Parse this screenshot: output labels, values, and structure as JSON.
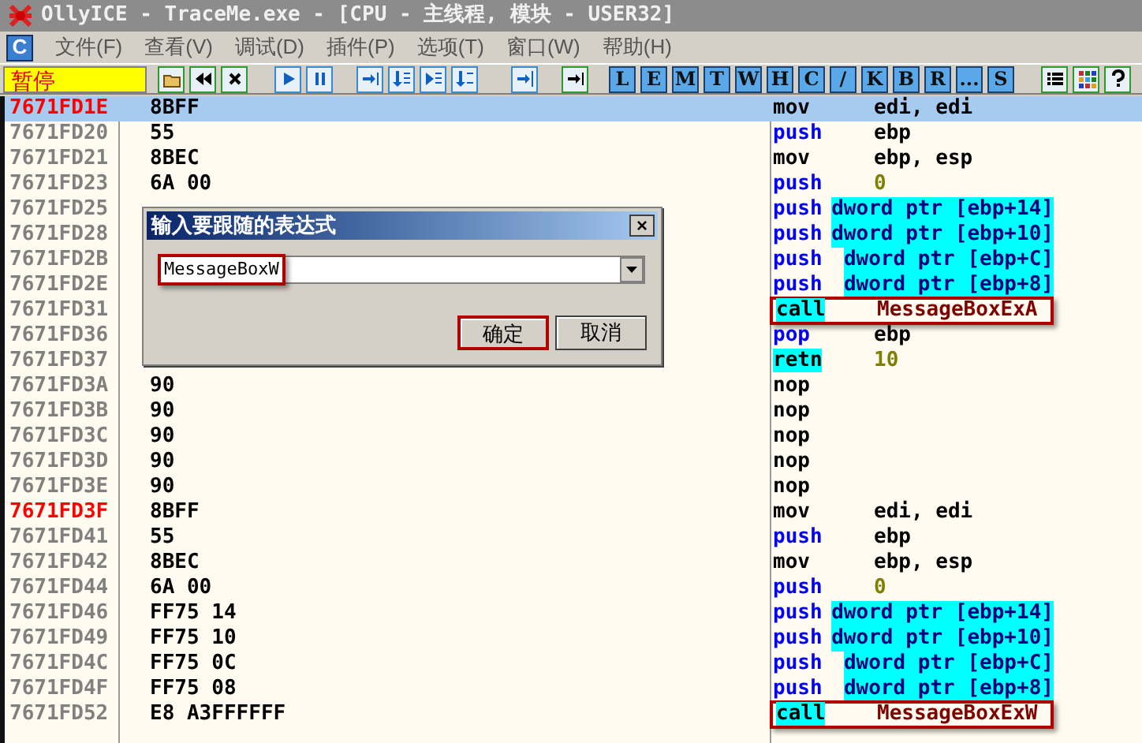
{
  "window": {
    "title": "OllyICE - TraceMe.exe - [CPU - 主线程, 模块 - USER32]"
  },
  "menu": {
    "app_icon_letter": "C",
    "items": [
      "文件(F)",
      "查看(V)",
      "调试(D)",
      "插件(P)",
      "选项(T)",
      "窗口(W)",
      "帮助(H)"
    ]
  },
  "toolbar": {
    "status": "暂停",
    "view_buttons": [
      "L",
      "E",
      "M",
      "T",
      "W",
      "H",
      "C",
      "/",
      "K",
      "B",
      "R",
      "...",
      "S"
    ]
  },
  "disassembly": {
    "rows": [
      {
        "address": "7671FD1E",
        "hex": "8BFF",
        "mnemonic": "mov",
        "kind": "plain",
        "operand": {
          "text": "edi, edi",
          "kind": "reg"
        },
        "selected": true,
        "entry": true,
        "annotated": false
      },
      {
        "address": "7671FD20",
        "hex": "55",
        "mnemonic": "push",
        "kind": "stack",
        "operand": {
          "text": "ebp",
          "kind": "reg"
        },
        "selected": false,
        "entry": false,
        "annotated": false
      },
      {
        "address": "7671FD21",
        "hex": "8BEC",
        "mnemonic": "mov",
        "kind": "plain",
        "operand": {
          "text": "ebp, esp",
          "kind": "reg"
        },
        "selected": false,
        "entry": false,
        "annotated": false
      },
      {
        "address": "7671FD23",
        "hex": "6A 00",
        "mnemonic": "push",
        "kind": "stack",
        "operand": {
          "text": "0",
          "kind": "const"
        },
        "selected": false,
        "entry": false,
        "annotated": false
      },
      {
        "address": "7671FD25",
        "mnemonic": "push",
        "kind": "stack",
        "operand": {
          "text": "dword ptr [ebp+14]",
          "kind": "mem"
        },
        "selected": false,
        "entry": false,
        "annotated": false
      },
      {
        "address": "7671FD28",
        "mnemonic": "push",
        "kind": "stack",
        "operand": {
          "text": "dword ptr [ebp+10]",
          "kind": "mem"
        },
        "selected": false,
        "entry": false,
        "annotated": false
      },
      {
        "address": "7671FD2B",
        "mnemonic": "push",
        "kind": "stack",
        "operand": {
          "text": "dword ptr [ebp+C]",
          "kind": "mem"
        },
        "selected": false,
        "entry": false,
        "annotated": false
      },
      {
        "address": "7671FD2E",
        "mnemonic": "push",
        "kind": "stack",
        "operand": {
          "text": "dword ptr [ebp+8]",
          "kind": "mem"
        },
        "selected": false,
        "entry": false,
        "annotated": false
      },
      {
        "address": "7671FD31",
        "mnemonic": "call",
        "kind": "call",
        "operand": {
          "text": "MessageBoxExA",
          "kind": "symbol"
        },
        "selected": false,
        "entry": false,
        "annotated": true
      },
      {
        "address": "7671FD36",
        "mnemonic": "pop",
        "kind": "stack",
        "operand": {
          "text": "ebp",
          "kind": "reg"
        },
        "selected": false,
        "entry": false,
        "annotated": false
      },
      {
        "address": "7671FD37",
        "mnemonic": "retn",
        "kind": "return",
        "operand": {
          "text": "10",
          "kind": "const"
        },
        "selected": false,
        "entry": false,
        "annotated": false
      },
      {
        "address": "7671FD3A",
        "hex": "90",
        "mnemonic": "nop",
        "kind": "plain",
        "selected": false,
        "entry": false,
        "annotated": false
      },
      {
        "address": "7671FD3B",
        "hex": "90",
        "mnemonic": "nop",
        "kind": "plain",
        "selected": false,
        "entry": false,
        "annotated": false
      },
      {
        "address": "7671FD3C",
        "hex": "90",
        "mnemonic": "nop",
        "kind": "plain",
        "selected": false,
        "entry": false,
        "annotated": false
      },
      {
        "address": "7671FD3D",
        "hex": "90",
        "mnemonic": "nop",
        "kind": "plain",
        "selected": false,
        "entry": false,
        "annotated": false
      },
      {
        "address": "7671FD3E",
        "hex": "90",
        "mnemonic": "nop",
        "kind": "plain",
        "selected": false,
        "entry": false,
        "annotated": false
      },
      {
        "address": "7671FD3F",
        "hex": "8BFF",
        "mnemonic": "mov",
        "kind": "plain",
        "operand": {
          "text": "edi, edi",
          "kind": "reg"
        },
        "selected": false,
        "entry": true,
        "annotated": false
      },
      {
        "address": "7671FD41",
        "hex": "55",
        "mnemonic": "push",
        "kind": "stack",
        "operand": {
          "text": "ebp",
          "kind": "reg"
        },
        "selected": false,
        "entry": false,
        "annotated": false
      },
      {
        "address": "7671FD42",
        "hex": "8BEC",
        "mnemonic": "mov",
        "kind": "plain",
        "operand": {
          "text": "ebp, esp",
          "kind": "reg"
        },
        "selected": false,
        "entry": false,
        "annotated": false
      },
      {
        "address": "7671FD44",
        "hex": "6A 00",
        "mnemonic": "push",
        "kind": "stack",
        "operand": {
          "text": "0",
          "kind": "const"
        },
        "selected": false,
        "entry": false,
        "annotated": false
      },
      {
        "address": "7671FD46",
        "hex": "FF75 14",
        "mnemonic": "push",
        "kind": "stack",
        "operand": {
          "text": "dword ptr [ebp+14]",
          "kind": "mem"
        },
        "selected": false,
        "entry": false,
        "annotated": false
      },
      {
        "address": "7671FD49",
        "hex": "FF75 10",
        "mnemonic": "push",
        "kind": "stack",
        "operand": {
          "text": "dword ptr [ebp+10]",
          "kind": "mem"
        },
        "selected": false,
        "entry": false,
        "annotated": false
      },
      {
        "address": "7671FD4C",
        "hex": "FF75 0C",
        "mnemonic": "push",
        "kind": "stack",
        "operand": {
          "text": "dword ptr [ebp+C]",
          "kind": "mem"
        },
        "selected": false,
        "entry": false,
        "annotated": false
      },
      {
        "address": "7671FD4F",
        "hex": "FF75 08",
        "mnemonic": "push",
        "kind": "stack",
        "operand": {
          "text": "dword ptr [ebp+8]",
          "kind": "mem"
        },
        "selected": false,
        "entry": false,
        "annotated": false
      },
      {
        "address": "7671FD52",
        "hex": "E8 A3FFFFFF",
        "mnemonic": "call",
        "kind": "call",
        "operand": {
          "text": "MessageBoxExW",
          "kind": "symbol"
        },
        "selected": false,
        "entry": false,
        "annotated": true
      }
    ]
  },
  "dialog": {
    "title": "输入要跟随的表达式",
    "close": "×",
    "value": "MessageBoxW",
    "value_annotated": true,
    "buttons": [
      {
        "label": "确定",
        "annotated": true
      },
      {
        "label": "取消",
        "annotated": false
      }
    ]
  }
}
